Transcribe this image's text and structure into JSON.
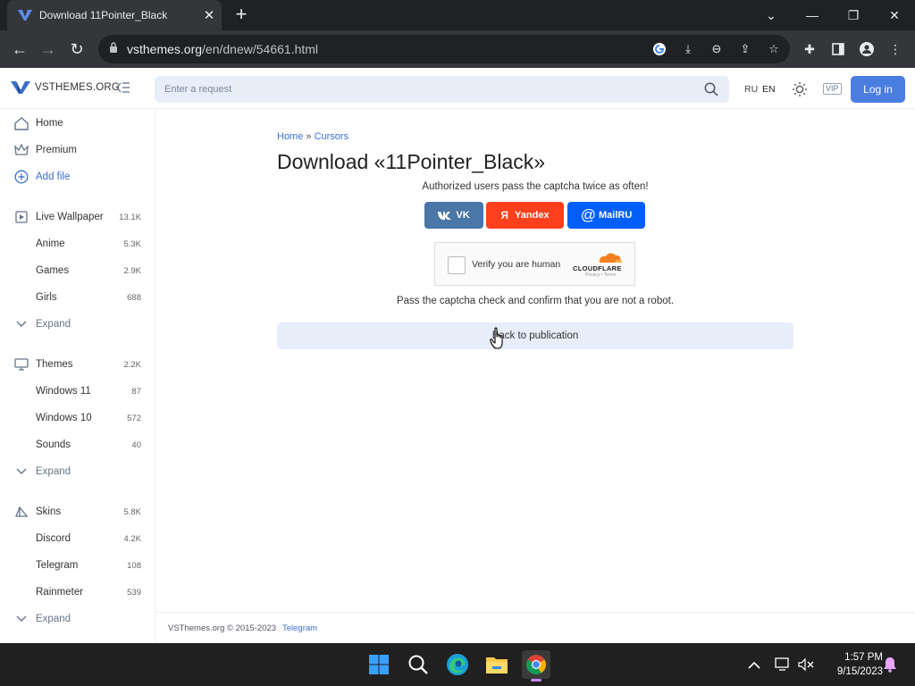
{
  "browser": {
    "tab_title": "Download 11Pointer_Black",
    "url_domain": "vsthemes.org",
    "url_path": "/en/dnew/54661.html"
  },
  "header": {
    "logo_text": "VSTHEMES.ORG",
    "search_placeholder": "Enter a request",
    "lang_ru": "RU",
    "lang_en": "EN",
    "vip": "VIP",
    "login": "Log in"
  },
  "sidebar": {
    "home": "Home",
    "premium": "Premium",
    "add_file": "Add file",
    "items": [
      {
        "label": "Live Wallpaper",
        "count": "13.1K"
      },
      {
        "label": "Anime",
        "count": "5.3K"
      },
      {
        "label": "Games",
        "count": "2.9K"
      },
      {
        "label": "Girls",
        "count": "688"
      },
      {
        "label": "Expand",
        "count": ""
      },
      {
        "label": "Themes",
        "count": "2.2K"
      },
      {
        "label": "Windows 11",
        "count": "87"
      },
      {
        "label": "Windows 10",
        "count": "572"
      },
      {
        "label": "Sounds",
        "count": "40"
      },
      {
        "label": "Expand",
        "count": ""
      },
      {
        "label": "Skins",
        "count": "5.8K"
      },
      {
        "label": "Discord",
        "count": "4.2K"
      },
      {
        "label": "Telegram",
        "count": "108"
      },
      {
        "label": "Rainmeter",
        "count": "539"
      },
      {
        "label": "Expand",
        "count": ""
      }
    ]
  },
  "main": {
    "breadcrumb_home": "Home",
    "breadcrumb_sep": " » ",
    "breadcrumb_current": "Cursors",
    "title": "Download «11Pointer_Black»",
    "auth_note": "Authorized users pass the captcha twice as often!",
    "vk": "VK",
    "yandex": "Yandex",
    "mailru": "MailRU",
    "captcha_label": "Verify you are human",
    "captcha_brand": "CLOUDFLARE",
    "captcha_sub": "Privacy • Terms",
    "pass_note": "Pass the captcha check and confirm that you are not a robot.",
    "back": "Back to publication"
  },
  "footer": {
    "copyright": "VSThemes.org © 2015-2023",
    "telegram": "Telegram"
  },
  "taskbar": {
    "time": "1:57 PM",
    "date": "9/15/2023"
  },
  "colors": {
    "accent": "#4a7de0",
    "vk": "#4a76a8",
    "yandex": "#fc3f1d",
    "mailru": "#005ff9"
  }
}
